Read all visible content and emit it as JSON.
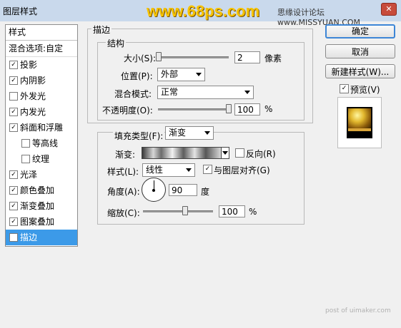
{
  "window": {
    "title": "图层样式",
    "banner": "www.68ps.com",
    "watermark_top": "思缘设计论坛 www.MISSYUAN.COM",
    "close": "✕"
  },
  "style_list": {
    "header": "样式",
    "blend": "混合选项:自定",
    "items": [
      {
        "label": "投影",
        "checked": "✓"
      },
      {
        "label": "内阴影",
        "checked": "✓"
      },
      {
        "label": "外发光",
        "checked": ""
      },
      {
        "label": "内发光",
        "checked": "✓"
      },
      {
        "label": "斜面和浮雕",
        "checked": "✓"
      },
      {
        "label": "等高线",
        "checked": ""
      },
      {
        "label": "纹理",
        "checked": ""
      },
      {
        "label": "光泽",
        "checked": "✓"
      },
      {
        "label": "颜色叠加",
        "checked": "✓"
      },
      {
        "label": "渐变叠加",
        "checked": "✓"
      },
      {
        "label": "图案叠加",
        "checked": "✓"
      },
      {
        "label": "描边",
        "checked": "✓"
      }
    ]
  },
  "stroke": {
    "section_title": "描边",
    "structure": {
      "title": "结构",
      "size_label": "大小(S):",
      "size_value": "2",
      "size_unit": "像素",
      "size_level": 0.01,
      "position_label": "位置(P):",
      "position_value": "外部",
      "blend_label": "混合模式:",
      "blend_value": "正常",
      "opacity_label": "不透明度(O):",
      "opacity_value": "100",
      "opacity_unit": "%",
      "opacity_level": 1.0
    },
    "fill": {
      "type_label": "填充类型(F):",
      "type_value": "渐变",
      "gradient_label": "渐变:",
      "reverse_label": "反向(R)",
      "reverse_checked": "",
      "style_label": "样式(L):",
      "style_value": "线性",
      "align_label": "与图层对齐(G)",
      "align_checked": "✓",
      "angle_label": "角度(A):",
      "angle_value": "90",
      "angle_unit": "度",
      "scale_label": "缩放(C):",
      "scale_value": "100",
      "scale_unit": "%",
      "scale_level": 0.6
    }
  },
  "buttons": {
    "ok": "确定",
    "cancel": "取消",
    "new_style": "新建样式(W)...",
    "preview_label": "预览(V)",
    "preview_checked": "✓"
  },
  "watermark_bottom": "post of uimaker.com"
}
